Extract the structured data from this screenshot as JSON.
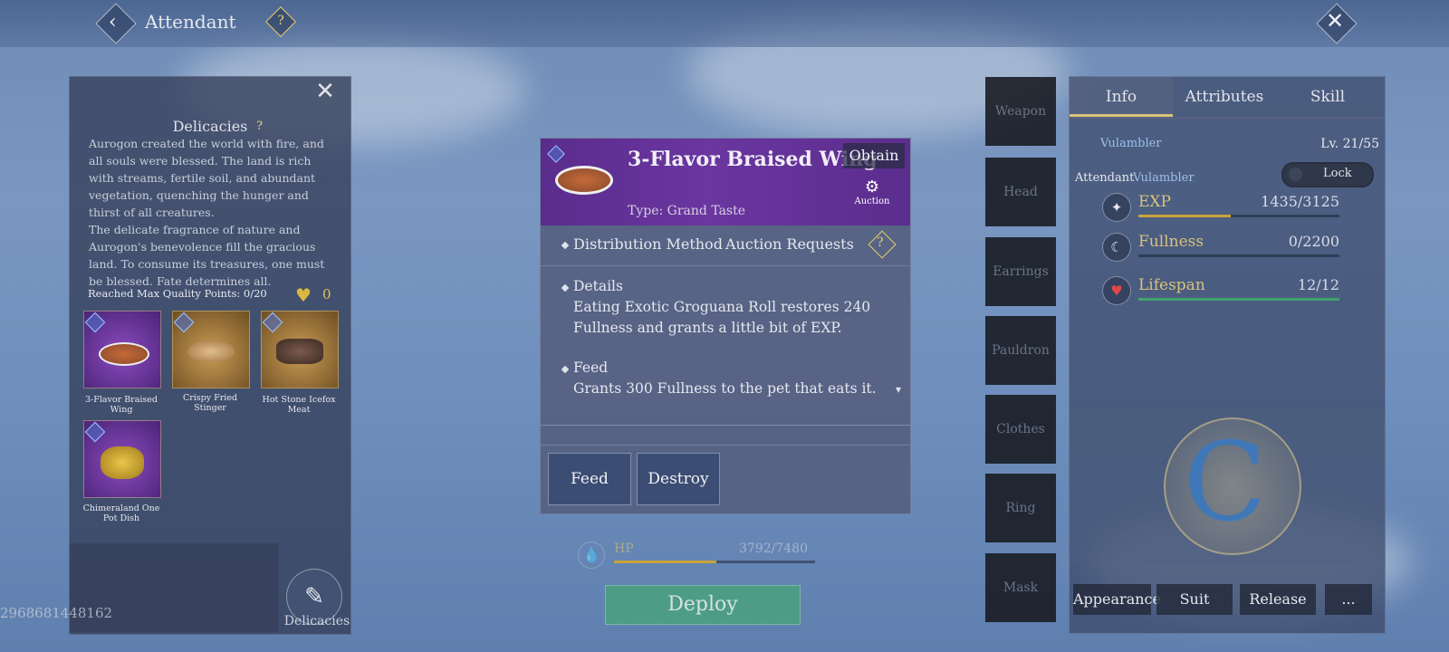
{
  "header": {
    "title": "Attendant",
    "help_icon": "question-icon",
    "back_icon": "chevron-left-icon",
    "close_icon": "close-icon"
  },
  "uid": "2968681448162",
  "delicacies_panel": {
    "title": "Delicacies",
    "description": "Aurogon created the world with fire, and all souls were blessed. The land is rich with streams, fertile soil, and abundant vegetation, quenching the hunger and thirst of all creatures.\nThe delicate fragrance of nature and Aurogon's benevolence fill the gracious land. To consume its treasures, one must be blessed. Fate determines all.",
    "max_quality": "Reached Max Quality Points: 0/20",
    "heart_count": "0",
    "items": [
      {
        "name": "3-Flavor Braised Wing",
        "rarity": "purple"
      },
      {
        "name": "Crispy Fried Stinger",
        "rarity": "gold"
      },
      {
        "name": "Hot Stone Icefox Meat",
        "rarity": "gold"
      },
      {
        "name": "Chimeraland One Pot Dish",
        "rarity": "purple"
      }
    ],
    "bottom_button": "Delicacies"
  },
  "item_detail": {
    "name": "3-Flavor Braised Wing",
    "type": "Type: Grand Taste",
    "obtain": "Obtain",
    "auction_label": "Auction",
    "distribution": "Distribution Method",
    "auction_requests": "Auction Requests",
    "details_title": "Details",
    "details_text": "Eating Exotic Groguana Roll restores 240 Fullness and grants a little bit of EXP.",
    "feed_title": "Feed",
    "feed_text": "Grants 300 Fullness to the pet that eats it.",
    "buttons": {
      "feed": "Feed",
      "destroy": "Destroy"
    }
  },
  "hp": {
    "label": "HP",
    "value": "3792/7480",
    "fraction": 0.507
  },
  "deploy_label": "Deploy",
  "equipment_slots": [
    "Weapon",
    "Head",
    "Earrings",
    "Pauldron",
    "Clothes",
    "Ring",
    "Mask"
  ],
  "info_panel": {
    "tabs": [
      "Info",
      "Attributes",
      "Skill"
    ],
    "pet_name": "Vulambler",
    "level": "Lv. 21/55",
    "attendant_label": "Attendant",
    "attendant_name": "Vulambler",
    "lock_label": "Lock",
    "stats": [
      {
        "name": "EXP",
        "value": "1435/3125",
        "fraction": 0.459,
        "color": "#c9a43a"
      },
      {
        "name": "Fullness",
        "value": "0/2200",
        "fraction": 0.0,
        "color": "#c9a43a"
      },
      {
        "name": "Lifespan",
        "value": "12/12",
        "fraction": 1.0,
        "color": "#3fa36a"
      }
    ],
    "bottom_buttons": [
      "Appearance",
      "Suit",
      "Release",
      "..."
    ]
  }
}
